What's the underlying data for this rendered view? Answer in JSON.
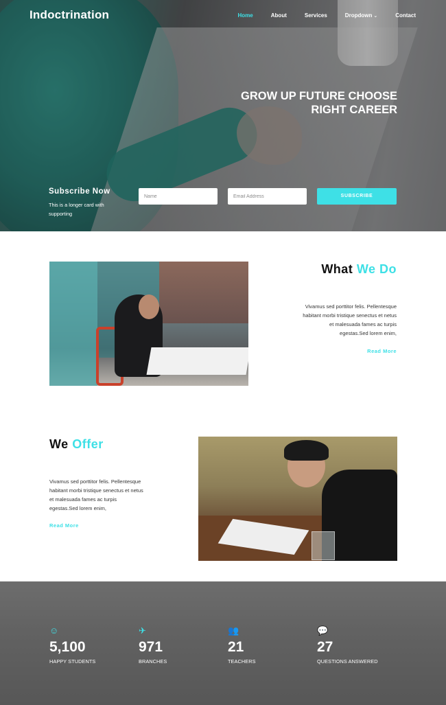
{
  "nav": {
    "brand": "Indoctrination",
    "items": [
      {
        "label": "Home",
        "active": true
      },
      {
        "label": "About",
        "active": false
      },
      {
        "label": "Services",
        "active": false
      },
      {
        "label": "Dropdown",
        "active": false,
        "has_caret": true
      },
      {
        "label": "Contact",
        "active": false
      }
    ]
  },
  "hero": {
    "title_line1": "GROW UP FUTURE CHOOSE",
    "title_line2": "RIGHT CAREER"
  },
  "subscribe": {
    "title": "Subscribe Now",
    "text": "This is a longer card with supporting",
    "name_placeholder": "Name",
    "email_placeholder": "Email Address",
    "button_label": "SUBSCRIBE"
  },
  "what_we_do": {
    "title_plain": "What",
    "title_accent": "We Do",
    "paragraph": "Vivamus sed porttitor felis. Pellentesque habitant morbi tristique senectus et netus et malesuada fames ac turpis egestas.Sed lorem enim,",
    "read_more": "Read More"
  },
  "we_offer": {
    "title_plain": "We",
    "title_accent": "Offer",
    "paragraph": "Vivamus sed porttitor felis. Pellentesque habitant morbi tristique senectus et netus et malesuada fames ac turpis egestas.Sed lorem enim,",
    "read_more": "Read More"
  },
  "stats": [
    {
      "icon": "smile-icon",
      "glyph": "☺",
      "value": "5,100",
      "label": "HAPPY STUDENTS"
    },
    {
      "icon": "plane-icon",
      "glyph": "✈",
      "value": "971",
      "label": "BRANCHES"
    },
    {
      "icon": "users-icon",
      "glyph": "👥",
      "value": "21",
      "label": "TEACHERS"
    },
    {
      "icon": "comments-icon",
      "glyph": "💬",
      "value": "27",
      "label": "QUESTIONS ANSWERED"
    }
  ],
  "colors": {
    "accent": "#3ee0e6",
    "stats_bg": "#626262"
  }
}
